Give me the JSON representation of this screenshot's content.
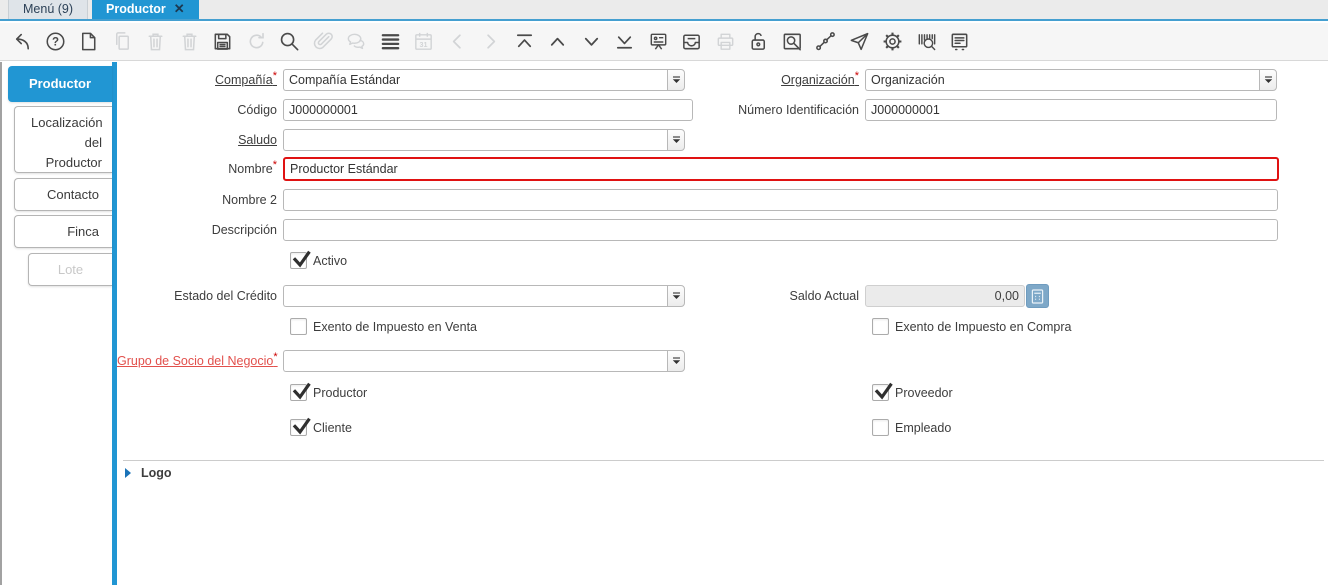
{
  "window_tabs": {
    "menu": "Menú (9)",
    "active": "Productor",
    "close_icon": "✕"
  },
  "toolbar": {
    "icons": [
      {
        "name": "undo",
        "disabled": false
      },
      {
        "name": "help",
        "disabled": false
      },
      {
        "name": "new-record",
        "disabled": false
      },
      {
        "name": "copy-record",
        "disabled": true
      },
      {
        "name": "delete-record",
        "disabled": true
      },
      {
        "name": "delete-selection",
        "disabled": true
      },
      {
        "name": "save",
        "disabled": false
      },
      {
        "name": "refresh",
        "disabled": true
      },
      {
        "name": "find",
        "disabled": false
      },
      {
        "name": "attachment",
        "disabled": true
      },
      {
        "name": "chat",
        "disabled": true
      },
      {
        "name": "toggle-detail-grid",
        "disabled": false
      },
      {
        "name": "calendar",
        "disabled": true
      },
      {
        "name": "parent-record",
        "disabled": true
      },
      {
        "name": "detail-record",
        "disabled": true
      },
      {
        "name": "first-record",
        "disabled": false
      },
      {
        "name": "previous-record",
        "disabled": false
      },
      {
        "name": "next-record",
        "disabled": false
      },
      {
        "name": "last-record",
        "disabled": false
      },
      {
        "name": "report",
        "disabled": false
      },
      {
        "name": "archive",
        "disabled": false
      },
      {
        "name": "print",
        "disabled": true
      },
      {
        "name": "lock",
        "disabled": false
      },
      {
        "name": "zoom-across",
        "disabled": false
      },
      {
        "name": "workflow",
        "disabled": false
      },
      {
        "name": "request",
        "disabled": false
      },
      {
        "name": "customize",
        "disabled": false
      },
      {
        "name": "product-info",
        "disabled": false
      },
      {
        "name": "quick-form",
        "disabled": false
      }
    ]
  },
  "sidebar": {
    "tabs": [
      {
        "label": "Productor",
        "state": "active"
      },
      {
        "label": "Localización del Productor",
        "state": "normal"
      },
      {
        "label": "Contacto",
        "state": "normal"
      },
      {
        "label": "Finca",
        "state": "normal"
      },
      {
        "label": "Lote",
        "state": "disabled"
      }
    ]
  },
  "form": {
    "required_marker": "*",
    "compania": {
      "label": "Compañía",
      "required": true,
      "value": "Compañía Estándar"
    },
    "organizacion": {
      "label": "Organización",
      "required": true,
      "value": "Organización"
    },
    "codigo": {
      "label": "Código",
      "value": "J000000001"
    },
    "numero_identificacion": {
      "label": "Número Identificación",
      "value": "J000000001"
    },
    "saludo": {
      "label": "Saludo",
      "value": ""
    },
    "nombre": {
      "label": "Nombre",
      "required": true,
      "value": "Productor Estándar",
      "highlighted": true
    },
    "nombre2": {
      "label": "Nombre 2",
      "value": ""
    },
    "descripcion": {
      "label": "Descripción",
      "value": ""
    },
    "activo": {
      "label": "Activo",
      "checked": true
    },
    "estado_credito": {
      "label": "Estado del Crédito",
      "value": ""
    },
    "saldo_actual": {
      "label": "Saldo Actual",
      "value": "0,00",
      "readonly": true
    },
    "exento_venta": {
      "label": "Exento de Impuesto en Venta",
      "checked": false
    },
    "exento_compra": {
      "label": "Exento de Impuesto en Compra",
      "checked": false
    },
    "grupo_socio": {
      "label": "Grupo de Socio del Negocio",
      "required": true,
      "value": ""
    },
    "productor": {
      "label": "Productor",
      "checked": true
    },
    "proveedor": {
      "label": "Proveedor",
      "checked": true
    },
    "cliente": {
      "label": "Cliente",
      "checked": true
    },
    "empleado": {
      "label": "Empleado",
      "checked": false
    },
    "logo_group": {
      "label": "Logo"
    }
  },
  "colors": {
    "accent_blue": "#2196d3",
    "tab_underline": "#449fd0",
    "highlight_border": "#e01212",
    "required_red": "#cc0000",
    "mandatory_label_red": "#e2504c",
    "saldo_button_blue": "#7ea8c8",
    "icon_dark": "#4a4a4a",
    "icon_disabled": "#d2d4d6"
  }
}
